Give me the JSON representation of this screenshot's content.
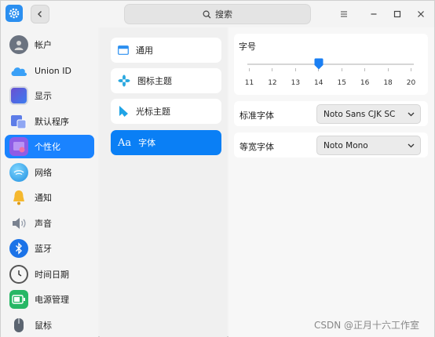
{
  "window": {
    "search_label": "搜索",
    "app_icon": "gear-icon"
  },
  "sidebar": {
    "items": [
      {
        "label": "帐户",
        "icon": "account-icon",
        "active": false
      },
      {
        "label": "Union ID",
        "icon": "cloud-icon",
        "active": false
      },
      {
        "label": "显示",
        "icon": "display-icon",
        "active": false
      },
      {
        "label": "默认程序",
        "icon": "default-apps-icon",
        "active": false
      },
      {
        "label": "个性化",
        "icon": "personalization-icon",
        "active": true
      },
      {
        "label": "网络",
        "icon": "network-icon",
        "active": false
      },
      {
        "label": "通知",
        "icon": "bell-icon",
        "active": false
      },
      {
        "label": "声音",
        "icon": "speaker-icon",
        "active": false
      },
      {
        "label": "蓝牙",
        "icon": "bluetooth-icon",
        "active": false
      },
      {
        "label": "时间日期",
        "icon": "clock-icon",
        "active": false
      },
      {
        "label": "电源管理",
        "icon": "battery-icon",
        "active": false
      },
      {
        "label": "鼠标",
        "icon": "mouse-icon",
        "active": false
      }
    ]
  },
  "subnav": {
    "items": [
      {
        "label": "通用",
        "icon": "window-icon",
        "active": false
      },
      {
        "label": "图标主题",
        "icon": "icon-theme-icon",
        "active": false
      },
      {
        "label": "光标主题",
        "icon": "cursor-icon",
        "active": false
      },
      {
        "label": "字体",
        "icon": "font-icon",
        "glyph": "Aa",
        "active": true
      }
    ]
  },
  "font_settings": {
    "size_title": "字号",
    "size_ticks": [
      "11",
      "12",
      "13",
      "14",
      "15",
      "16",
      "18",
      "20"
    ],
    "size_value": "14",
    "standard_label": "标准字体",
    "standard_value": "Noto Sans CJK SC",
    "mono_label": "等宽字体",
    "mono_value": "Noto Mono"
  },
  "watermark": "CSDN @正月十六工作室",
  "colors": {
    "accent": "#1a83ff"
  }
}
